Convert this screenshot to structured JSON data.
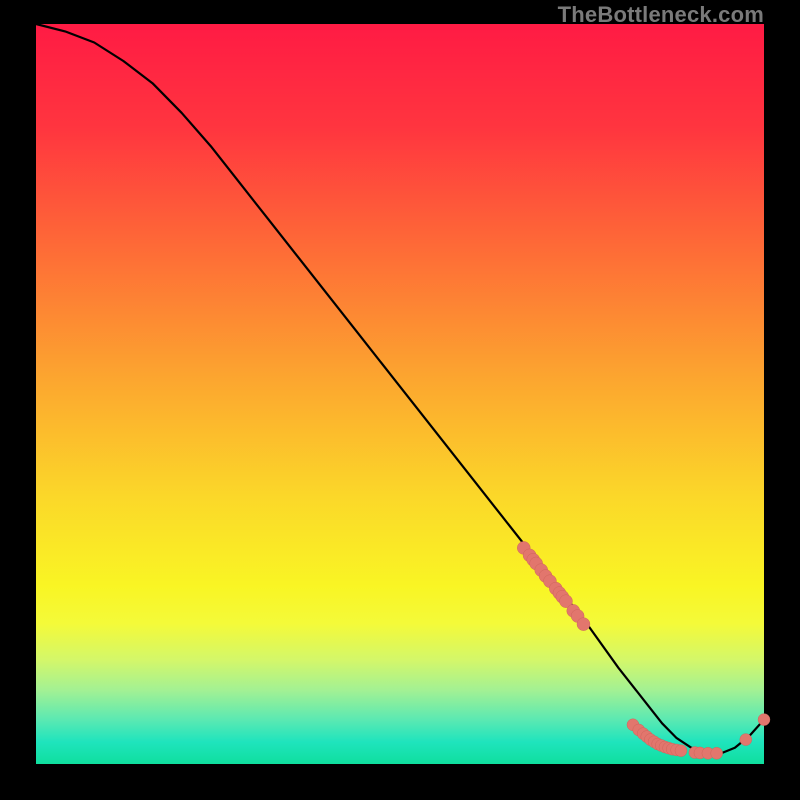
{
  "watermark": "TheBottleneck.com",
  "gradient_stops": [
    {
      "pct": 0,
      "color": "#ff1b44"
    },
    {
      "pct": 14,
      "color": "#ff353f"
    },
    {
      "pct": 30,
      "color": "#fe6a37"
    },
    {
      "pct": 48,
      "color": "#fca62f"
    },
    {
      "pct": 64,
      "color": "#fbd829"
    },
    {
      "pct": 76,
      "color": "#f9f524"
    },
    {
      "pct": 81,
      "color": "#f4fa39"
    },
    {
      "pct": 86,
      "color": "#d3f76a"
    },
    {
      "pct": 90,
      "color": "#a3f193"
    },
    {
      "pct": 94,
      "color": "#5be9b2"
    },
    {
      "pct": 97,
      "color": "#1fe4bd"
    },
    {
      "pct": 100,
      "color": "#0fdf9e"
    }
  ],
  "chart_data": {
    "type": "line",
    "title": "",
    "xlabel": "",
    "ylabel": "",
    "xlim": [
      0,
      100
    ],
    "ylim": [
      0,
      100
    ],
    "grid": false,
    "legend": false,
    "series": [
      {
        "name": "bottleneck-curve",
        "x": [
          0,
          4,
          8,
          12,
          16,
          20,
          24,
          28,
          32,
          36,
          40,
          44,
          48,
          52,
          56,
          60,
          64,
          68,
          72,
          76,
          80,
          82,
          84,
          86,
          88,
          90,
          92,
          94,
          96,
          98,
          100
        ],
        "y": [
          100,
          99,
          97.5,
          95,
          92,
          88,
          83.5,
          78.5,
          73.5,
          68.5,
          63.5,
          58.5,
          53.5,
          48.5,
          43.5,
          38.5,
          33.5,
          28.5,
          23.5,
          18.5,
          13,
          10.5,
          8,
          5.5,
          3.5,
          2.2,
          1.5,
          1.4,
          2.2,
          3.8,
          6
        ]
      }
    ],
    "points_cluster_diag": {
      "name": "markers-on-slope",
      "x": [
        67,
        67.8,
        68.3,
        68.7,
        69.4,
        70,
        70.6,
        71.4,
        71.9,
        72.3,
        72.8,
        73.8,
        74.4,
        75.2
      ],
      "y": [
        29.2,
        28.2,
        27.6,
        27.1,
        26.2,
        25.4,
        24.7,
        23.7,
        23.1,
        22.6,
        22,
        20.7,
        20,
        18.9
      ]
    },
    "points_cluster_flat": {
      "name": "markers-at-min",
      "x": [
        82,
        82.8,
        83.4,
        83.9,
        84.4,
        84.9,
        85.4,
        85.9,
        86.4,
        86.9,
        87.4,
        88,
        88.6,
        90.5,
        91.2,
        92.3,
        93.5,
        97.5,
        100
      ],
      "y": [
        5.3,
        4.6,
        4.1,
        3.7,
        3.3,
        3,
        2.7,
        2.5,
        2.3,
        2.15,
        2,
        1.9,
        1.8,
        1.55,
        1.5,
        1.45,
        1.45,
        3.3,
        6
      ]
    }
  }
}
